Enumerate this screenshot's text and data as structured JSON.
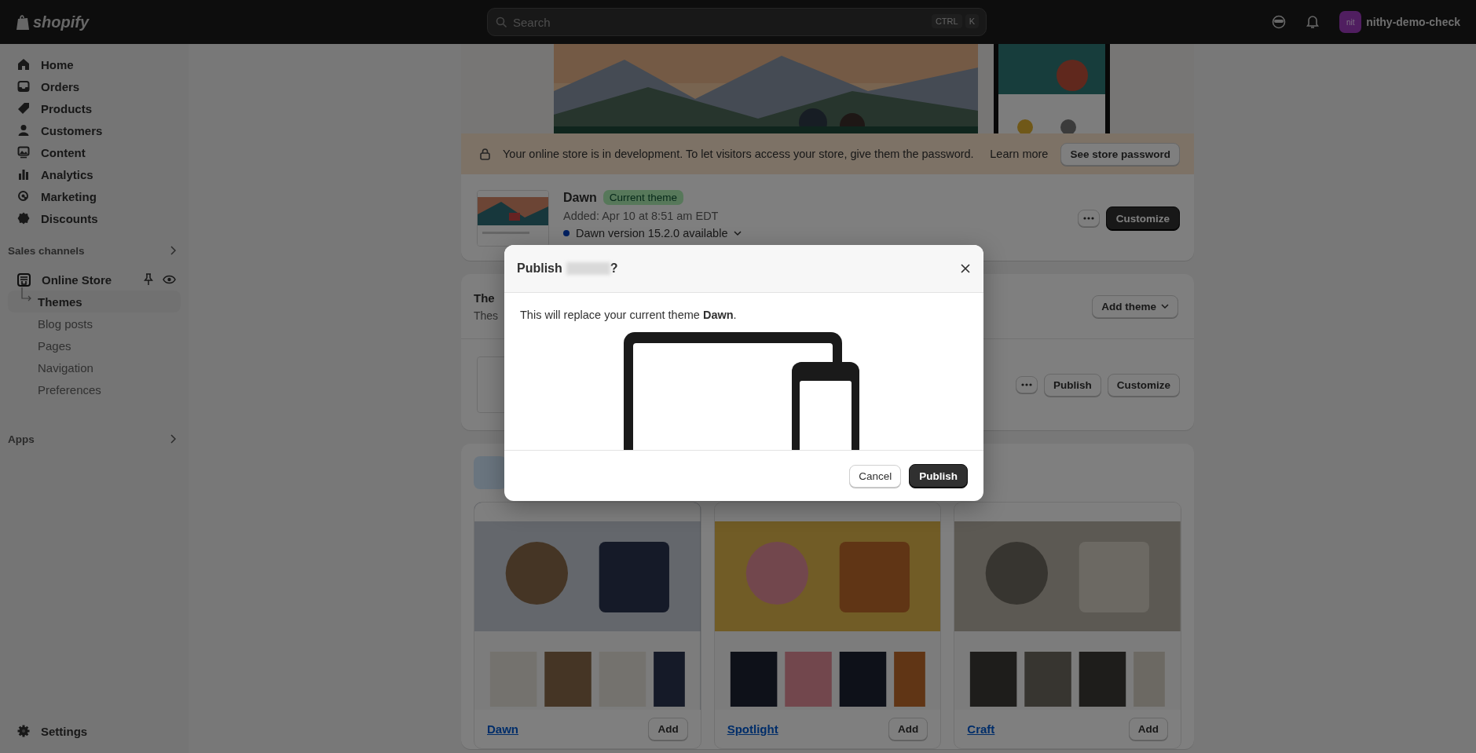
{
  "top_bar": {
    "logo": "shopify",
    "search": {
      "placeholder": "Search",
      "shortcut": [
        "CTRL",
        "K"
      ]
    },
    "account": {
      "initials": "nit",
      "name": "nithy-demo-check"
    }
  },
  "sidebar": {
    "items": [
      {
        "label": "Home",
        "selected": false
      },
      {
        "label": "Orders",
        "selected": false
      },
      {
        "label": "Products",
        "selected": false
      },
      {
        "label": "Customers",
        "selected": false
      },
      {
        "label": "Content",
        "selected": false
      },
      {
        "label": "Analytics",
        "selected": false
      },
      {
        "label": "Marketing",
        "selected": false
      },
      {
        "label": "Discounts",
        "selected": false
      }
    ],
    "sales_channels": {
      "title": "Sales channels",
      "channel": {
        "label": "Online Store",
        "children": [
          {
            "label": "Themes",
            "selected": true
          },
          {
            "label": "Blog posts",
            "selected": false
          },
          {
            "label": "Pages",
            "selected": false
          },
          {
            "label": "Navigation",
            "selected": false
          },
          {
            "label": "Preferences",
            "selected": false
          }
        ]
      }
    },
    "apps": {
      "title": "Apps"
    },
    "settings": {
      "label": "Settings"
    }
  },
  "current_theme": {
    "banner": {
      "text": "Your online store is in development. To let visitors access your store, give them the password.",
      "link": "Learn more",
      "button": "See store password"
    },
    "name": "Dawn",
    "badge": "Current theme",
    "added": "Added: Apr 10 at 8:51 am EDT",
    "update": "Dawn version 15.2.0 available",
    "button": "Customize"
  },
  "theme_library": {
    "title": "The",
    "subtitle": "Thes",
    "add_button": "Add theme",
    "buttons": [
      "Publish",
      "Customize"
    ]
  },
  "free_themes": [
    {
      "name": "Dawn",
      "button": "Add"
    },
    {
      "name": "Spotlight",
      "button": "Add"
    },
    {
      "name": "Craft",
      "button": "Add"
    }
  ],
  "dialog": {
    "title_start": "Publish",
    "title_end": "?",
    "text": "This will replace your current theme **Dawn**.",
    "buttons": [
      {
        "label": "Cancel",
        "kind": "secondary"
      },
      {
        "label": "Publish",
        "kind": "primary"
      }
    ]
  }
}
